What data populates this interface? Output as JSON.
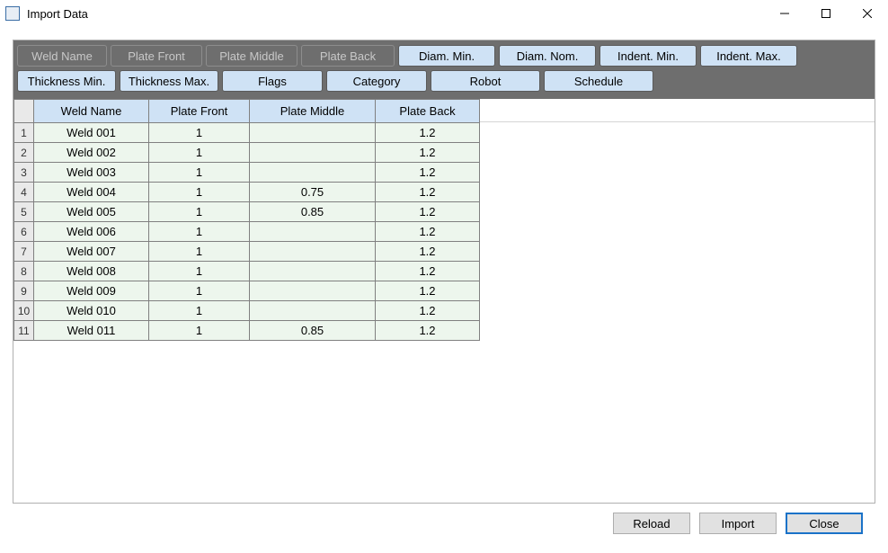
{
  "window": {
    "title": "Import Data"
  },
  "toolbar": {
    "row1": [
      {
        "label": "Weld Name",
        "dark": true
      },
      {
        "label": "Plate Front",
        "dark": true
      },
      {
        "label": "Plate Middle",
        "dark": true
      },
      {
        "label": "Plate Back",
        "dark": true
      },
      {
        "label": "Diam. Min.",
        "dark": false
      },
      {
        "label": "Diam. Nom.",
        "dark": false
      },
      {
        "label": "Indent. Min.",
        "dark": false
      },
      {
        "label": "Indent. Max.",
        "dark": false
      }
    ],
    "row2": [
      {
        "label": "Thickness Min.",
        "dark": false
      },
      {
        "label": "Thickness Max.",
        "dark": false
      },
      {
        "label": "Flags",
        "dark": false
      },
      {
        "label": "Category",
        "dark": false
      },
      {
        "label": "Robot",
        "dark": false
      },
      {
        "label": "Schedule",
        "dark": false
      }
    ]
  },
  "table": {
    "columns": [
      "Weld Name",
      "Plate Front",
      "Plate Middle",
      "Plate Back"
    ],
    "rows": [
      {
        "num": "1",
        "name": "Weld 001",
        "front": "1",
        "middle": "",
        "back": "1.2"
      },
      {
        "num": "2",
        "name": "Weld 002",
        "front": "1",
        "middle": "",
        "back": "1.2"
      },
      {
        "num": "3",
        "name": "Weld 003",
        "front": "1",
        "middle": "",
        "back": "1.2"
      },
      {
        "num": "4",
        "name": "Weld 004",
        "front": "1",
        "middle": "0.75",
        "back": "1.2"
      },
      {
        "num": "5",
        "name": "Weld 005",
        "front": "1",
        "middle": "0.85",
        "back": "1.2"
      },
      {
        "num": "6",
        "name": "Weld 006",
        "front": "1",
        "middle": "",
        "back": "1.2"
      },
      {
        "num": "7",
        "name": "Weld 007",
        "front": "1",
        "middle": "",
        "back": "1.2"
      },
      {
        "num": "8",
        "name": "Weld 008",
        "front": "1",
        "middle": "",
        "back": "1.2"
      },
      {
        "num": "9",
        "name": "Weld 009",
        "front": "1",
        "middle": "",
        "back": "1.2"
      },
      {
        "num": "10",
        "name": "Weld 010",
        "front": "1",
        "middle": "",
        "back": "1.2"
      },
      {
        "num": "11",
        "name": "Weld 011",
        "front": "1",
        "middle": "0.85",
        "back": "1.2"
      }
    ]
  },
  "footer": {
    "reload": "Reload",
    "import": "Import",
    "close": "Close"
  }
}
